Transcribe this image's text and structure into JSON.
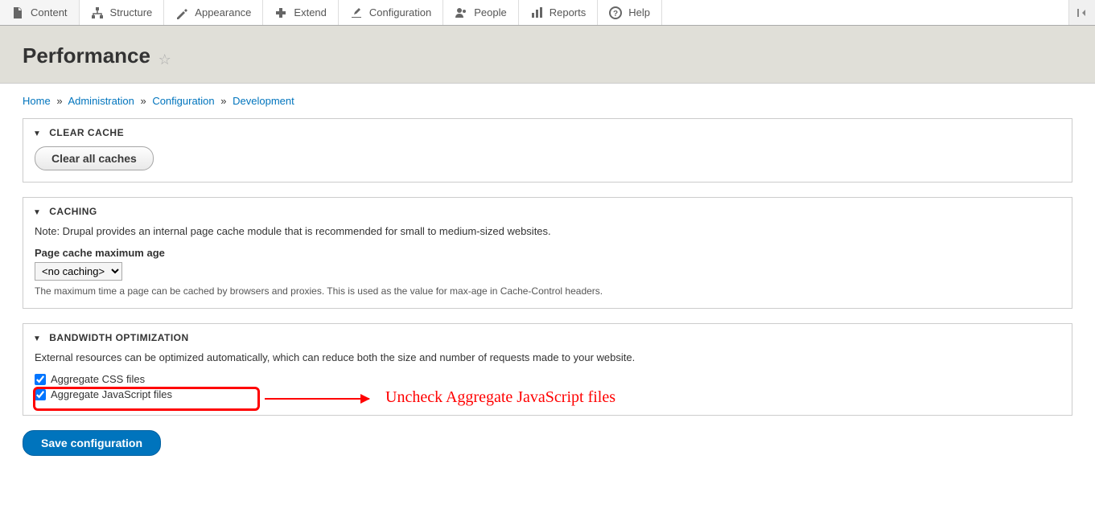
{
  "toolbar": {
    "items": [
      {
        "label": "Content",
        "icon": "content"
      },
      {
        "label": "Structure",
        "icon": "structure"
      },
      {
        "label": "Appearance",
        "icon": "appearance"
      },
      {
        "label": "Extend",
        "icon": "extend"
      },
      {
        "label": "Configuration",
        "icon": "config"
      },
      {
        "label": "People",
        "icon": "people"
      },
      {
        "label": "Reports",
        "icon": "reports"
      },
      {
        "label": "Help",
        "icon": "help"
      }
    ]
  },
  "page": {
    "title": "Performance"
  },
  "breadcrumb": {
    "home": "Home",
    "admin": "Administration",
    "config": "Configuration",
    "dev": "Development"
  },
  "panels": {
    "clear_cache": {
      "title": "Clear cache",
      "button": "Clear all caches"
    },
    "caching": {
      "title": "Caching",
      "note": "Note: Drupal provides an internal page cache module that is recommended for small to medium-sized websites.",
      "max_age_label": "Page cache maximum age",
      "max_age_value": "<no caching>",
      "max_age_desc": "The maximum time a page can be cached by browsers and proxies. This is used as the value for max-age in Cache-Control headers."
    },
    "bandwidth": {
      "title": "Bandwidth optimization",
      "note": "External resources can be optimized automatically, which can reduce both the size and number of requests made to your website.",
      "agg_css_label": "Aggregate CSS files",
      "agg_js_label": "Aggregate JavaScript files",
      "agg_css_checked": true,
      "agg_js_checked": true
    }
  },
  "actions": {
    "save": "Save configuration"
  },
  "annotation": {
    "text": "Uncheck Aggregate JavaScript files"
  }
}
